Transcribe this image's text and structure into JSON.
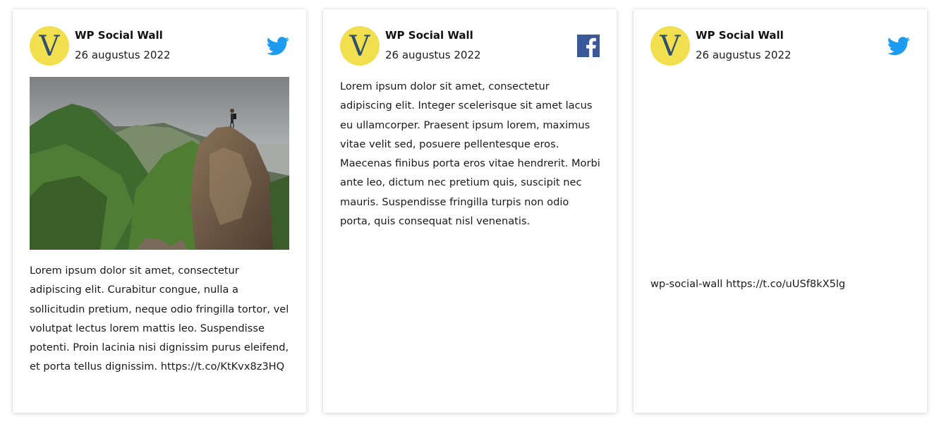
{
  "posts": [
    {
      "author": "WP Social Wall",
      "date": "26 augustus 2022",
      "network": "twitter",
      "network_icon": "twitter-bird-icon",
      "has_photo": true,
      "text": "Lorem ipsum dolor sit amet, consectetur adipiscing elit. Curabitur congue, nulla a sollicitudin pretium, neque odio fringilla tortor, vel volutpat lectus lorem mattis leo. Suspendisse potenti. Proin lacinia nisi dignissim purus eleifend, et porta tellus dignissim. https://t.co/KtKvx8z3HQ"
    },
    {
      "author": "WP Social Wall",
      "date": "26 augustus 2022",
      "network": "facebook",
      "network_icon": "facebook-icon",
      "has_photo": false,
      "text": "Lorem ipsum dolor sit amet, consectetur adipiscing elit. Integer scelerisque sit amet lacus eu ullamcorper. Praesent ipsum lorem, maximus vitae velit sed, posuere pellentesque eros. Maecenas finibus porta eros vitae hendrerit. Morbi ante leo, dictum nec pretium quis, suscipit nec mauris. Suspendisse fringilla turpis non odio porta, quis consequat nisl venenatis."
    },
    {
      "author": "WP Social Wall",
      "date": "26 augustus 2022",
      "network": "twitter",
      "network_icon": "twitter-bird-icon",
      "has_photo": false,
      "text": "wp-social-wall https://t.co/uUSf8kX5lg"
    }
  ],
  "colors": {
    "avatar_bg": "#f2df4f",
    "avatar_letter": "#2f4f6f",
    "twitter": "#1d9bf0",
    "facebook": "#3b5998"
  }
}
